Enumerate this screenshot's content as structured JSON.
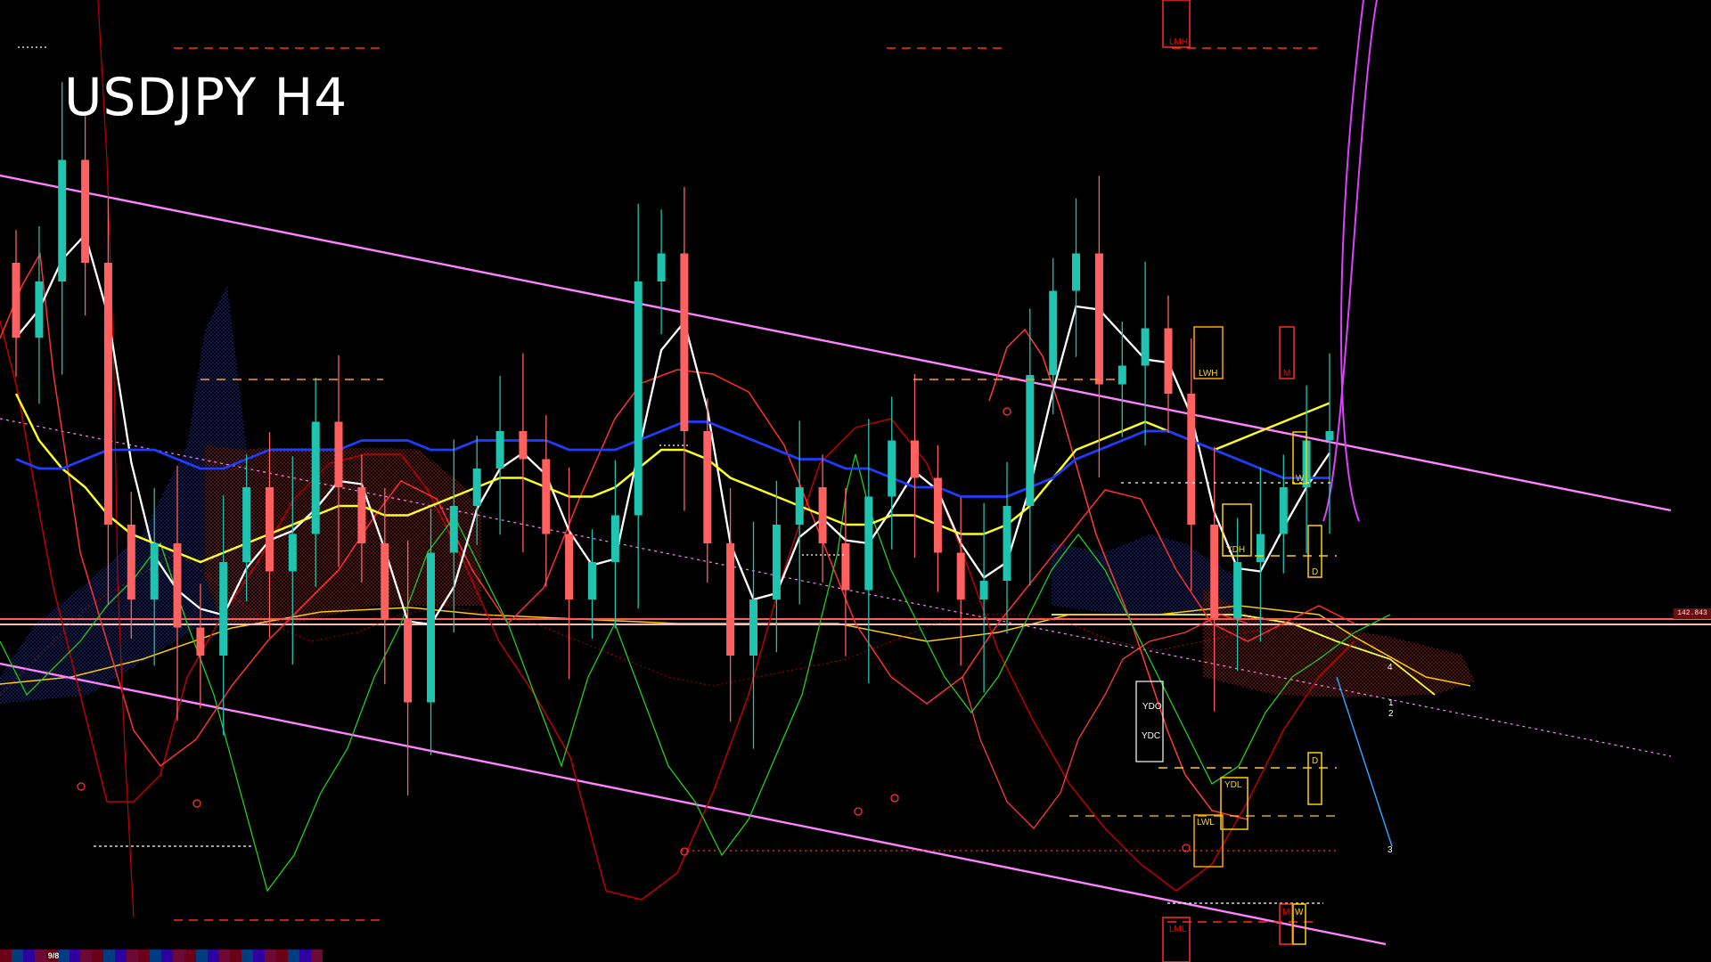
{
  "header": {
    "title": "USDJPY H4"
  },
  "status": {
    "counter_label": "9/8",
    "price_tag": "142.843"
  },
  "chart_data": {
    "type": "line",
    "title": "USDJPY H4",
    "xlabel": "",
    "ylabel": "",
    "grid": false,
    "annotations": [
      "LMH",
      "LWH",
      "M",
      "W",
      "YDH",
      "D",
      "YDO",
      "YDC",
      "YDL",
      "LWL",
      "LML",
      "M",
      "W",
      "1",
      "2",
      "3",
      "4"
    ],
    "series": [
      {
        "values": [
          143.2,
          143.8,
          145.1,
          144.0,
          141.2,
          140.4,
          141.0,
          140.1,
          139.8,
          140.8,
          141.6,
          140.7,
          141.1,
          142.3,
          141.6,
          141.0,
          140.2,
          139.3,
          140.9,
          141.4,
          141.8,
          142.2,
          141.9,
          141.1,
          140.4,
          140.8,
          141.3,
          143.8,
          144.1,
          142.2,
          141.0,
          139.8,
          140.4,
          141.2,
          141.6,
          141.0,
          140.5,
          141.5,
          142.1,
          141.7,
          140.9,
          140.4,
          140.6,
          141.4,
          142.8,
          143.7,
          144.1,
          142.7,
          142.9,
          143.3,
          142.6,
          141.2,
          140.2,
          140.8,
          141.1,
          141.6,
          142.1,
          142.2
        ]
      },
      {
        "values": [
          142.6,
          142.1,
          141.8,
          141.6,
          141.3,
          141.1,
          141.0,
          140.9,
          140.8,
          140.9,
          141.0,
          141.1,
          141.2,
          141.3,
          141.4,
          141.4,
          141.3,
          141.3,
          141.4,
          141.5,
          141.6,
          141.7,
          141.7,
          141.6,
          141.5,
          141.5,
          141.6,
          141.8,
          142.0,
          142.0,
          141.9,
          141.7,
          141.6,
          141.5,
          141.4,
          141.3,
          141.2,
          141.2,
          141.3,
          141.3,
          141.2,
          141.1,
          141.1,
          141.2,
          141.4,
          141.7,
          142.0,
          142.1,
          142.2,
          142.3,
          142.2,
          142.1,
          142.0,
          142.1,
          142.2,
          142.3,
          142.4,
          142.5
        ]
      },
      {
        "values": [
          141.9,
          141.8,
          141.8,
          141.9,
          142.0,
          142.0,
          142.0,
          141.9,
          141.8,
          141.8,
          141.9,
          142.0,
          142.0,
          142.0,
          142.0,
          142.1,
          142.1,
          142.1,
          142.0,
          142.0,
          142.1,
          142.1,
          142.1,
          142.1,
          142.0,
          142.0,
          142.0,
          142.1,
          142.2,
          142.3,
          142.3,
          142.2,
          142.1,
          142.0,
          141.9,
          141.9,
          141.8,
          141.8,
          141.7,
          141.6,
          141.6,
          141.5,
          141.5,
          141.5,
          141.6,
          141.7,
          141.9,
          142.0,
          142.1,
          142.2,
          142.2,
          142.1,
          142.0,
          141.9,
          141.8,
          141.7,
          141.7,
          141.7
        ]
      }
    ]
  }
}
